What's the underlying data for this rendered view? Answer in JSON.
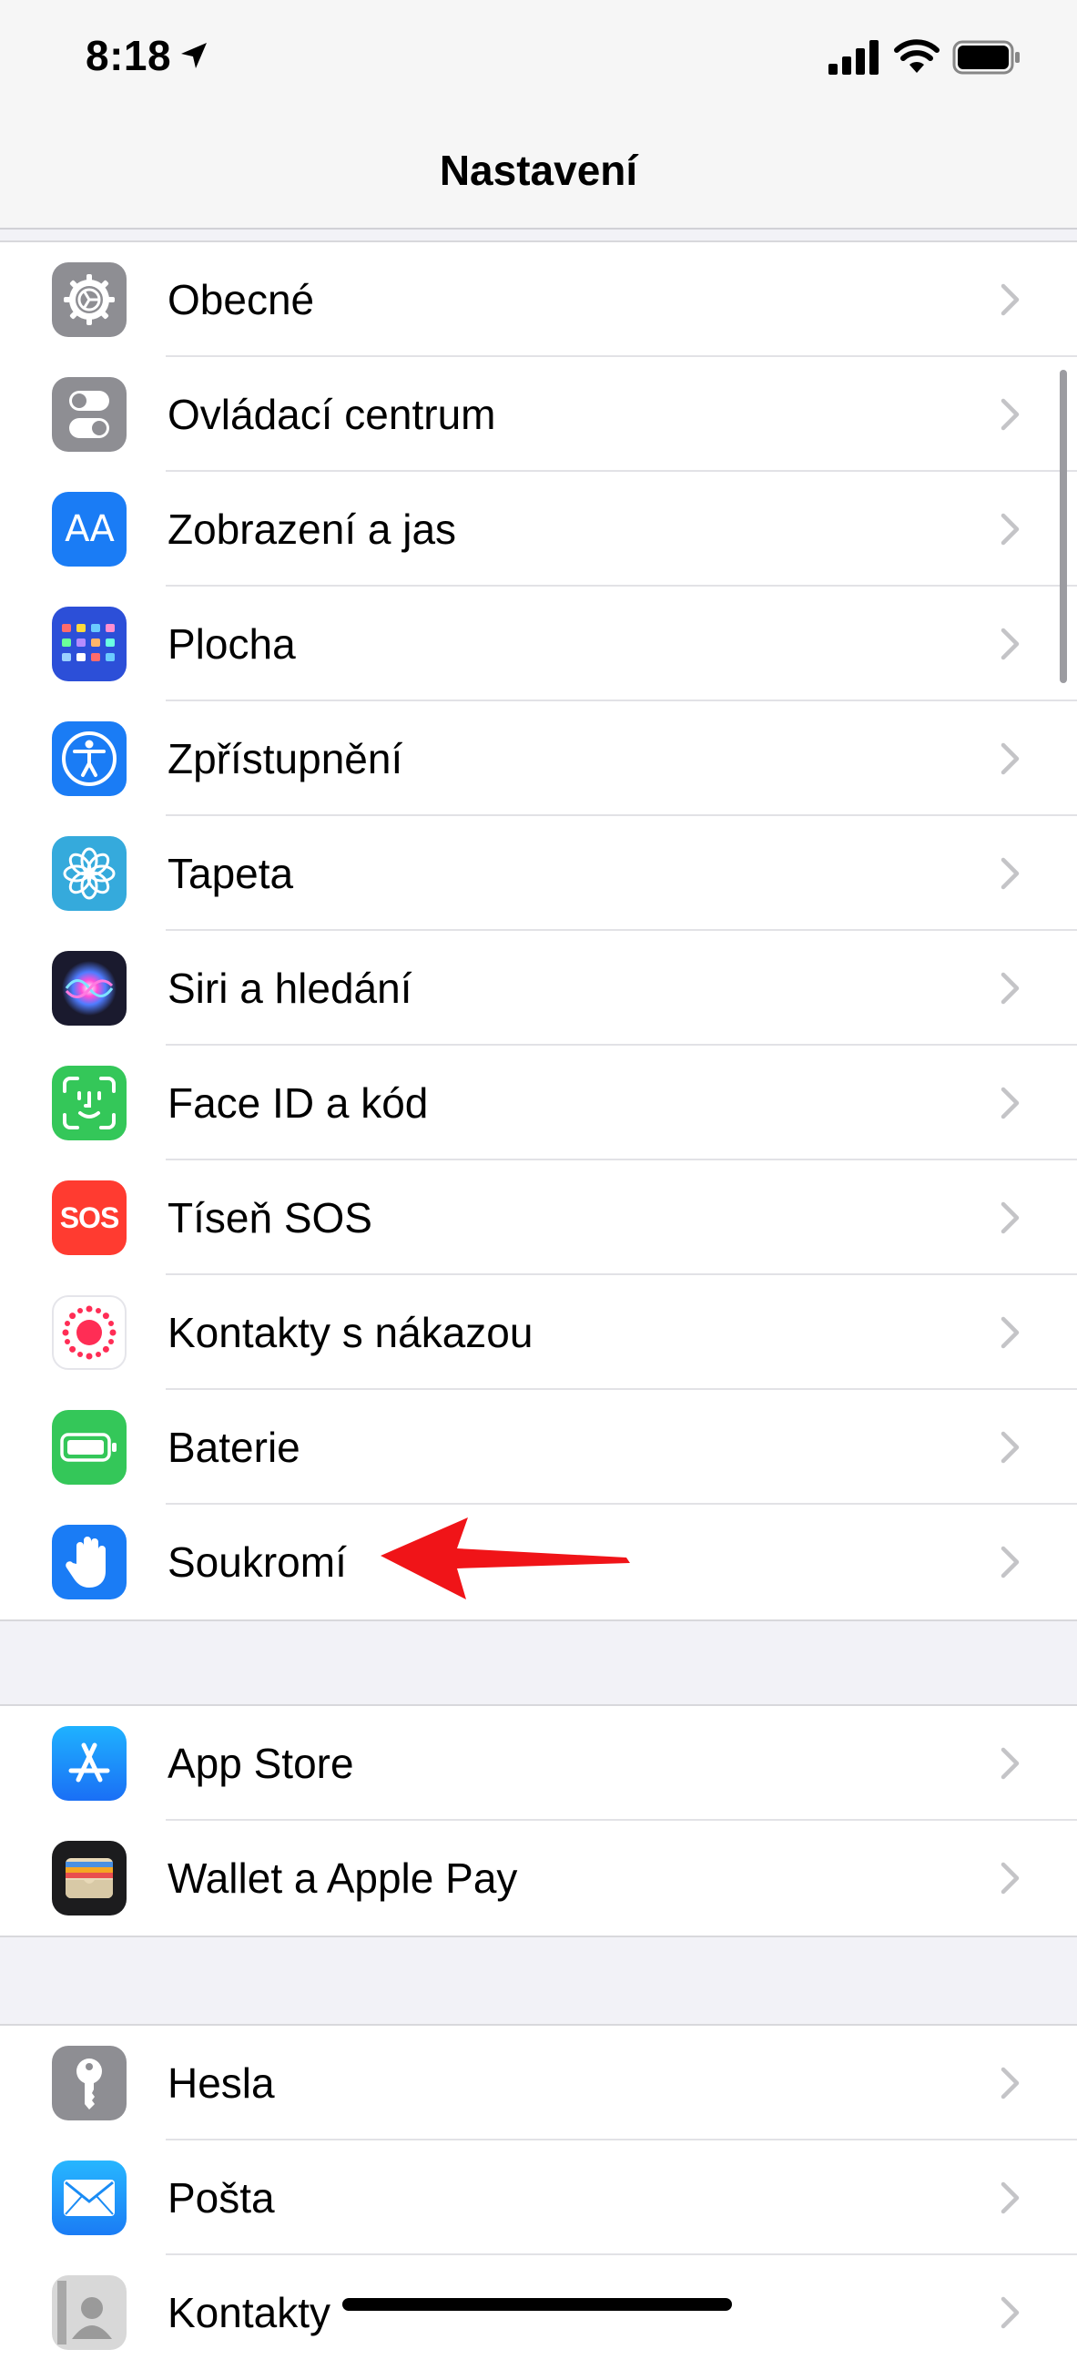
{
  "status_bar": {
    "time": "8:18"
  },
  "nav": {
    "title": "Nastavení"
  },
  "groups": [
    {
      "items": [
        {
          "label": "Obecné",
          "icon": "gear-icon",
          "color": "#8e8e93"
        },
        {
          "label": "Ovládací centrum",
          "icon": "toggles-icon",
          "color": "#8e8e93"
        },
        {
          "label": "Zobrazení a jas",
          "icon": "text-size-icon",
          "color": "#1a7cf5"
        },
        {
          "label": "Plocha",
          "icon": "home-grid-icon",
          "color": "#2c4fd8"
        },
        {
          "label": "Zpřístupnění",
          "icon": "accessibility-icon",
          "color": "#1a7cf5"
        },
        {
          "label": "Tapeta",
          "icon": "flower-icon",
          "color": "#35aadc"
        },
        {
          "label": "Siri a hledání",
          "icon": "siri-icon",
          "color": "#1a1a2e"
        },
        {
          "label": "Face ID a kód",
          "icon": "face-id-icon",
          "color": "#34c759"
        },
        {
          "label": "Tíseň SOS",
          "icon": "sos-icon",
          "color": "#ff3b30"
        },
        {
          "label": "Kontakty s nákazou",
          "icon": "exposure-icon",
          "color": "#ffffff"
        },
        {
          "label": "Baterie",
          "icon": "battery-icon",
          "color": "#34c759"
        },
        {
          "label": "Soukromí",
          "icon": "hand-icon",
          "color": "#1a7cf5"
        }
      ]
    },
    {
      "items": [
        {
          "label": "App Store",
          "icon": "app-store-icon",
          "color": "#1a8cf5"
        },
        {
          "label": "Wallet a Apple Pay",
          "icon": "wallet-icon",
          "color": "#1c1c1e"
        }
      ]
    },
    {
      "items": [
        {
          "label": "Hesla",
          "icon": "key-icon",
          "color": "#8e8e93"
        },
        {
          "label": "Pošta",
          "icon": "mail-icon",
          "color": "#1a8cf5"
        },
        {
          "label": "Kontakty",
          "icon": "contacts-icon",
          "color": "#d8d8d8"
        }
      ]
    }
  ],
  "icons_text": {
    "display": "AA",
    "sos": "SOS"
  },
  "colors": {
    "annotation_arrow": "#f01418",
    "chevron": "#c4c4c7"
  }
}
